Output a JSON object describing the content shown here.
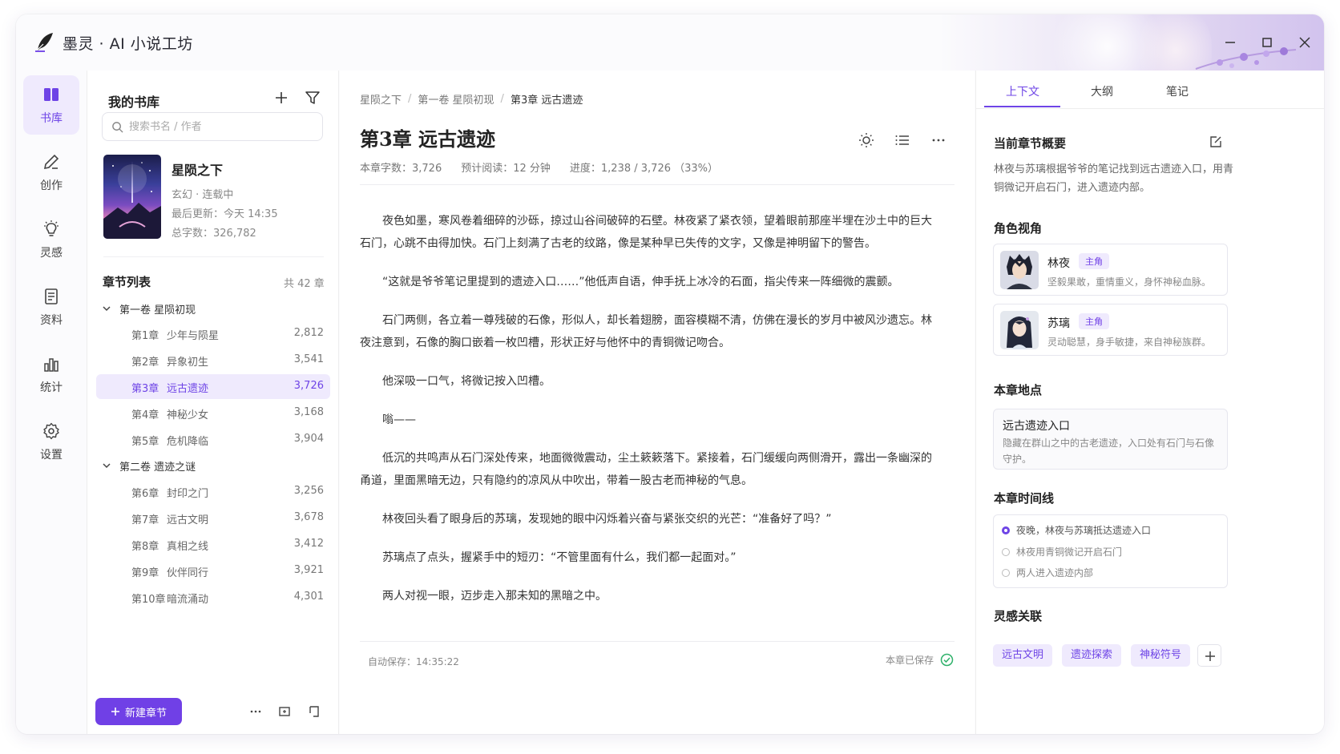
{
  "app": {
    "title": "墨灵 · AI 小说工坊"
  },
  "rail": [
    {
      "label": "书库",
      "icon": "book-icon",
      "active": true
    },
    {
      "label": "创作",
      "icon": "pen-icon",
      "active": false
    },
    {
      "label": "灵感",
      "icon": "lightbulb-icon",
      "active": false
    },
    {
      "label": "资料",
      "icon": "document-icon",
      "active": false
    },
    {
      "label": "统计",
      "icon": "bar-chart-icon",
      "active": false
    },
    {
      "label": "设置",
      "icon": "gear-icon",
      "active": false
    }
  ],
  "library": {
    "title": "我的书库",
    "search_placeholder": "搜索书名 / 作者",
    "book": {
      "title": "星陨之下",
      "genre": "玄幻 · 连载中",
      "updated": "最后更新：今天 14:35",
      "words": "总字数：326,782"
    },
    "chapters_title": "章节列表",
    "chapters_count": "共 42 章",
    "volumes": [
      {
        "name": "第一卷 星陨初现"
      },
      {
        "name": "第二卷 遗迹之谜"
      }
    ],
    "chapters": [
      {
        "num": "第1章",
        "name": "少年与陨星",
        "words": "2,812"
      },
      {
        "num": "第2章",
        "name": "异象初生",
        "words": "3,541"
      },
      {
        "num": "第3章",
        "name": "远古遗迹",
        "words": "3,726"
      },
      {
        "num": "第4章",
        "name": "神秘少女",
        "words": "3,168"
      },
      {
        "num": "第5章",
        "name": "危机降临",
        "words": "3,904"
      },
      {
        "num": "第6章",
        "name": "封印之门",
        "words": "3,256"
      },
      {
        "num": "第7章",
        "name": "远古文明",
        "words": "3,678"
      },
      {
        "num": "第8章",
        "name": "真相之线",
        "words": "3,412"
      },
      {
        "num": "第9章",
        "name": "伙伴同行",
        "words": "3,921"
      },
      {
        "num": "第10章",
        "name": "暗流涌动",
        "words": "4,301"
      }
    ],
    "new_chapter": "新建章节"
  },
  "editor": {
    "breadcrumb": [
      "星陨之下",
      "第一卷 星陨初现",
      "第3章 远古遗迹"
    ],
    "title": "第3章 远古遗迹",
    "stats": {
      "words": "本章字数：3,726",
      "read": "预计阅读：12 分钟",
      "progress": "进度：1,238 / 3,726 （33%）"
    },
    "paragraphs": [
      "夜色如墨，寒风卷着细碎的沙砾，掠过山谷间破碎的石壁。林夜紧了紧衣领，望着眼前那座半埋在沙土中的巨大石门，心跳不由得加快。石门上刻满了古老的纹路，像是某种早已失传的文字，又像是神明留下的警告。",
      "“这就是爷爷笔记里提到的遗迹入口……”他低声自语，伸手抚上冰冷的石面，指尖传来一阵细微的震颤。",
      "石门两侧，各立着一尊残破的石像，形似人，却长着翅膀，面容模糊不清，仿佛在漫长的岁月中被风沙遗忘。林夜注意到，石像的胸口嵌着一枚凹槽，形状正好与他怀中的青铜微记吻合。",
      "他深吸一口气，将微记按入凹槽。",
      "嗡——",
      "低沉的共鸣声从石门深处传来，地面微微震动，尘土簌簌落下。紧接着，石门缓缓向两侧滑开，露出一条幽深的甬道，里面黑暗无边，只有隐约的凉风从中吹出，带着一股古老而神秘的气息。",
      "林夜回头看了眼身后的苏璃，发现她的眼中闪烁着兴奋与紧张交织的光芒：“准备好了吗？”",
      "苏璃点了点头，握紧手中的短刃：“不管里面有什么，我们都一起面对。”",
      "两人对视一眼，迈步走入那未知的黑暗之中。"
    ],
    "autosave": "自动保存：14:35:22",
    "saved": "本章已保存"
  },
  "panel": {
    "tabs": [
      "上下文",
      "大纲",
      "笔记"
    ],
    "summary_title": "当前章节概要",
    "summary": "林夜与苏璃根据爷爷的笔记找到远古遗迹入口，用青铜微记开启石门，进入遗迹内部。",
    "characters_title": "角色视角",
    "characters": [
      {
        "name": "林夜",
        "badge": "主角",
        "desc": "坚毅果敢，重情重义，身怀神秘血脉。"
      },
      {
        "name": "苏璃",
        "badge": "主角",
        "desc": "灵动聪慧，身手敏捷，来自神秘族群。"
      }
    ],
    "location_title": "本章地点",
    "location": {
      "name": "远古遗迹入口",
      "desc": "隐藏在群山之中的古老遗迹，入口处有石门与石像守护。"
    },
    "timeline_title": "本章时间线",
    "timeline": [
      "夜晚，林夜与苏璃抵达遗迹入口",
      "林夜用青铜微记开启石门",
      "两人进入遗迹内部"
    ],
    "inspiration_title": "灵感关联",
    "tags": [
      "远古文明",
      "遗迹探索",
      "神秘符号"
    ],
    "accent": "#6e44e6"
  }
}
